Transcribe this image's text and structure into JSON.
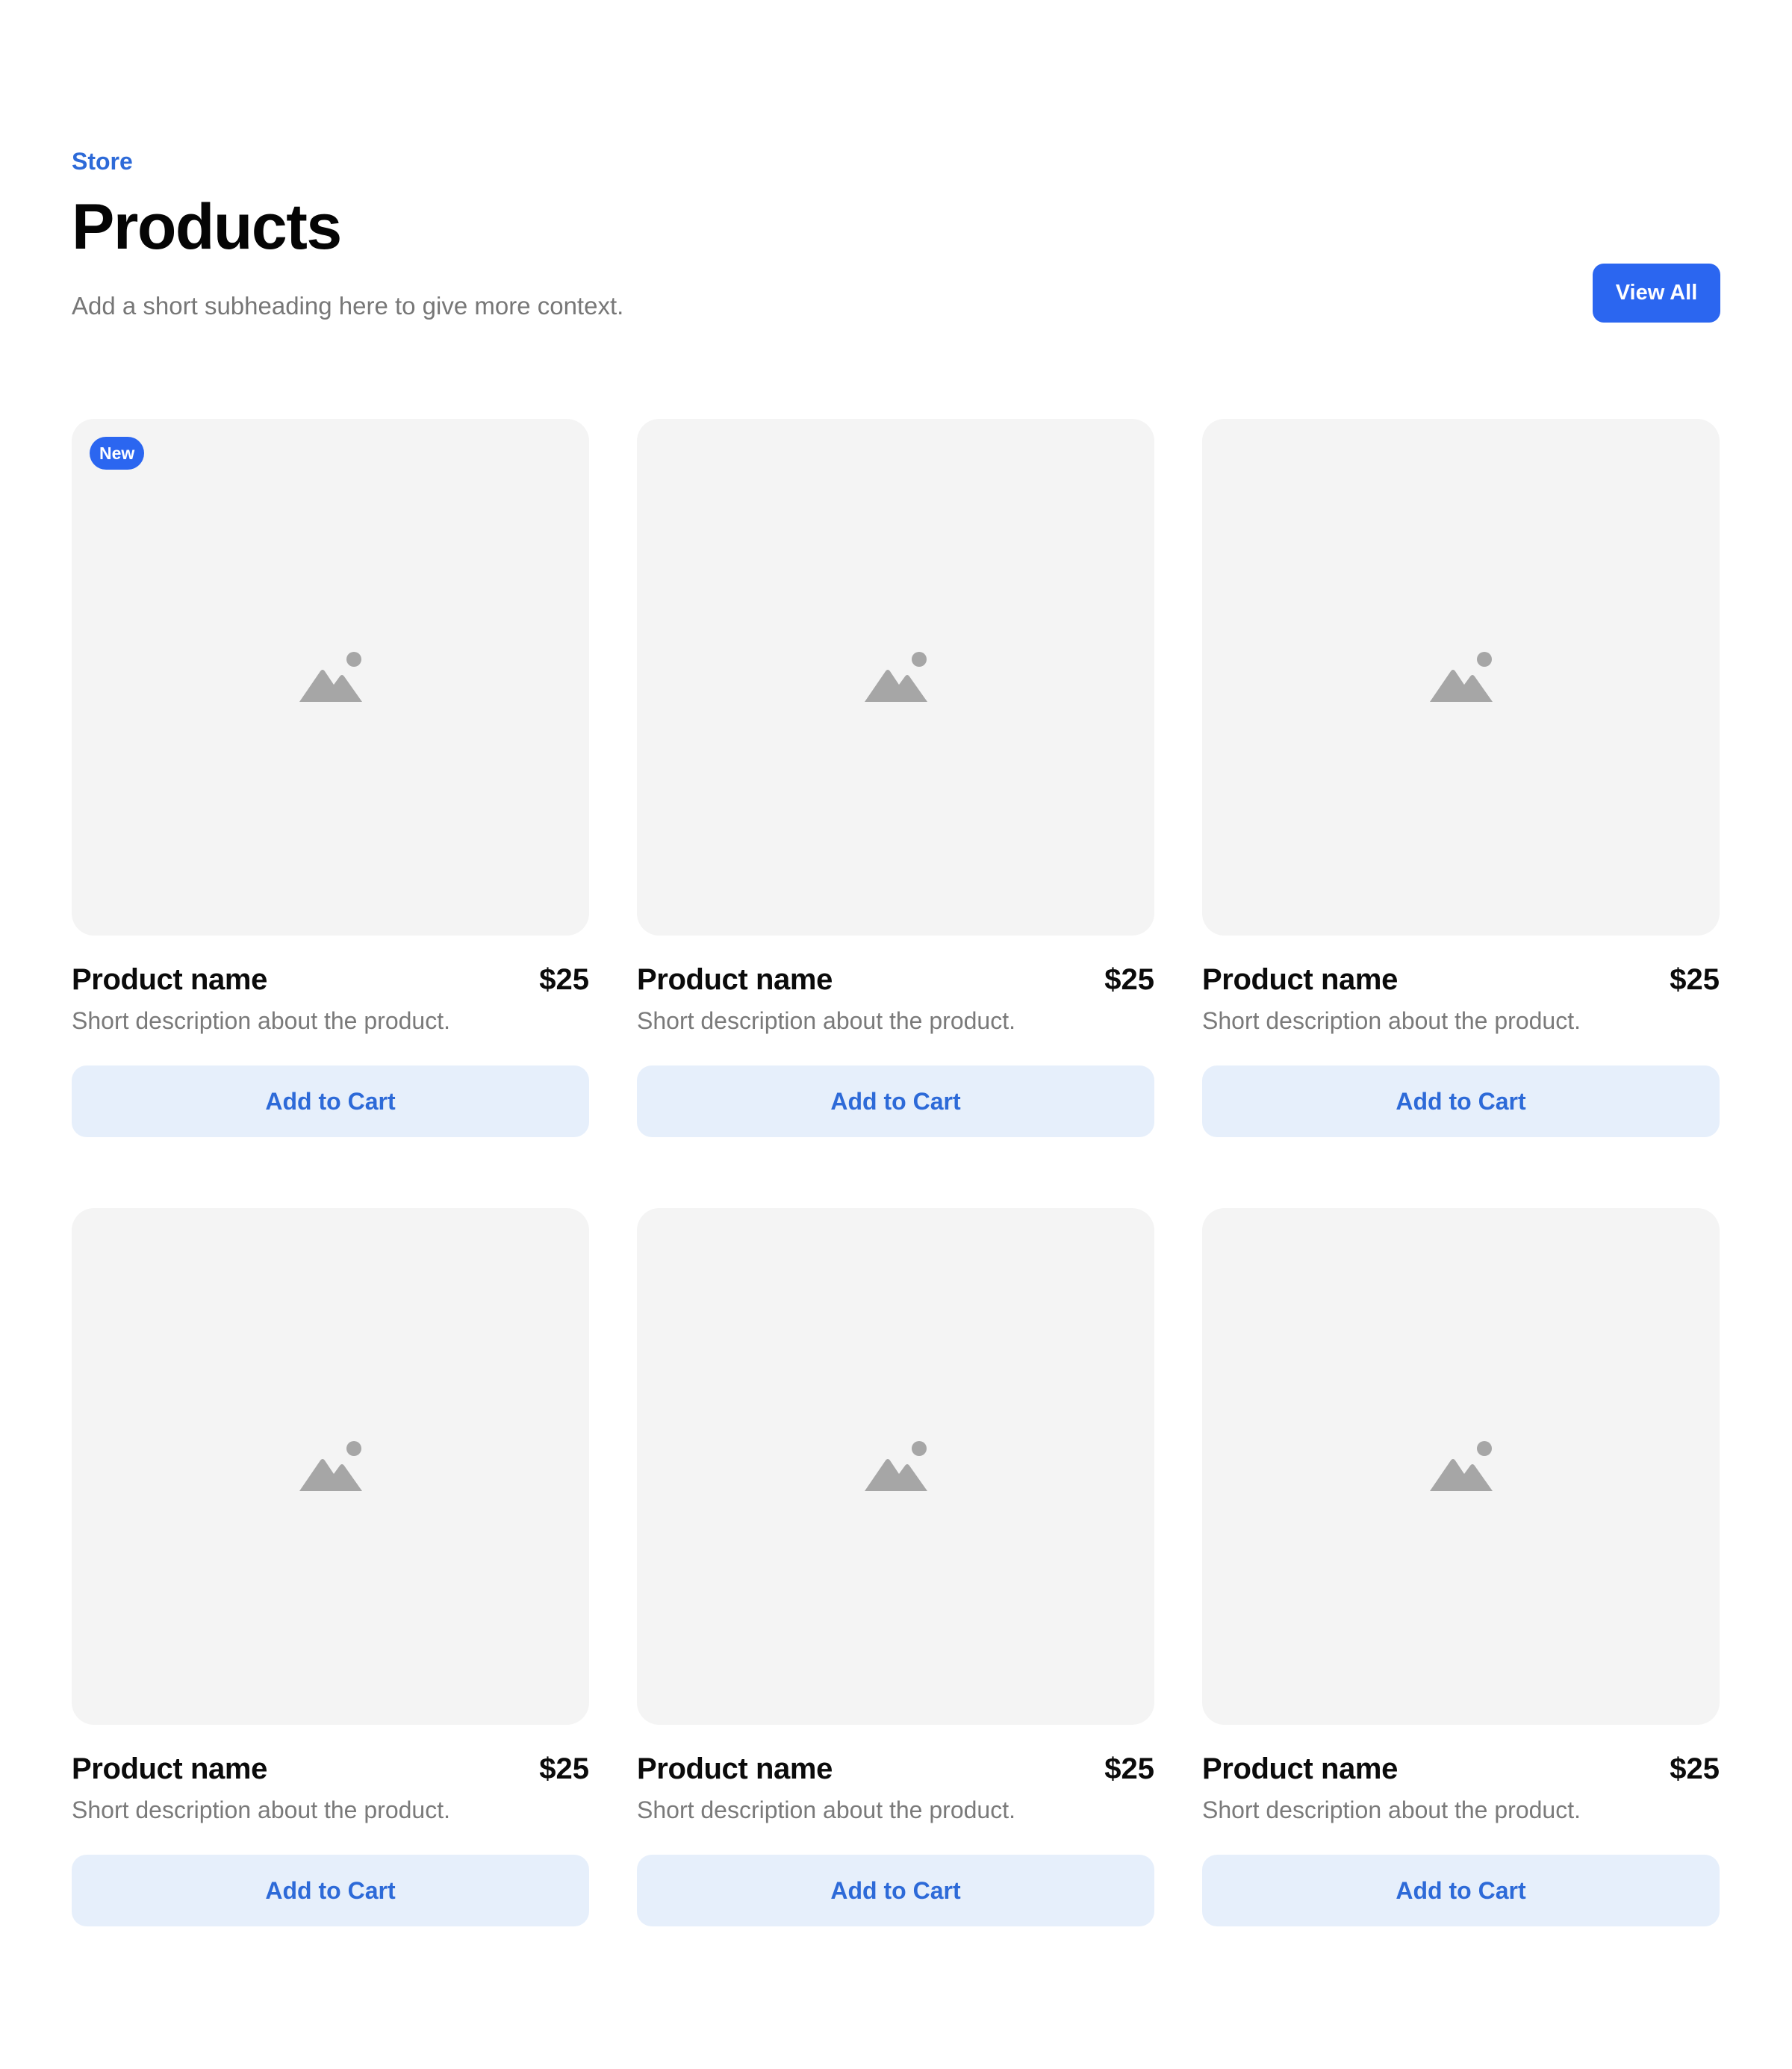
{
  "header": {
    "eyebrow": "Store",
    "title": "Products",
    "subtitle": "Add a short subheading here to give more context.",
    "view_all_label": "View All"
  },
  "colors": {
    "accent": "#2b66f0",
    "accent_text": "#2d6ad8",
    "cart_button_bg": "#e6effb",
    "image_placeholder_bg": "#f4f4f4",
    "placeholder_icon": "#a6a6a6"
  },
  "products": [
    {
      "badge": "New",
      "name": "Product name",
      "price": "$25",
      "description": "Short description about the product.",
      "button_label": "Add to Cart",
      "icon": "image-placeholder-icon"
    },
    {
      "badge": "",
      "name": "Product name",
      "price": "$25",
      "description": "Short description about the product.",
      "button_label": "Add to Cart",
      "icon": "image-placeholder-icon"
    },
    {
      "badge": "",
      "name": "Product name",
      "price": "$25",
      "description": "Short description about the product.",
      "button_label": "Add to Cart",
      "icon": "image-placeholder-icon"
    },
    {
      "badge": "",
      "name": "Product name",
      "price": "$25",
      "description": "Short description about the product.",
      "button_label": "Add to Cart",
      "icon": "image-placeholder-icon"
    },
    {
      "badge": "",
      "name": "Product name",
      "price": "$25",
      "description": "Short description about the product.",
      "button_label": "Add to Cart",
      "icon": "image-placeholder-icon"
    },
    {
      "badge": "",
      "name": "Product name",
      "price": "$25",
      "description": "Short description about the product.",
      "button_label": "Add to Cart",
      "icon": "image-placeholder-icon"
    }
  ]
}
